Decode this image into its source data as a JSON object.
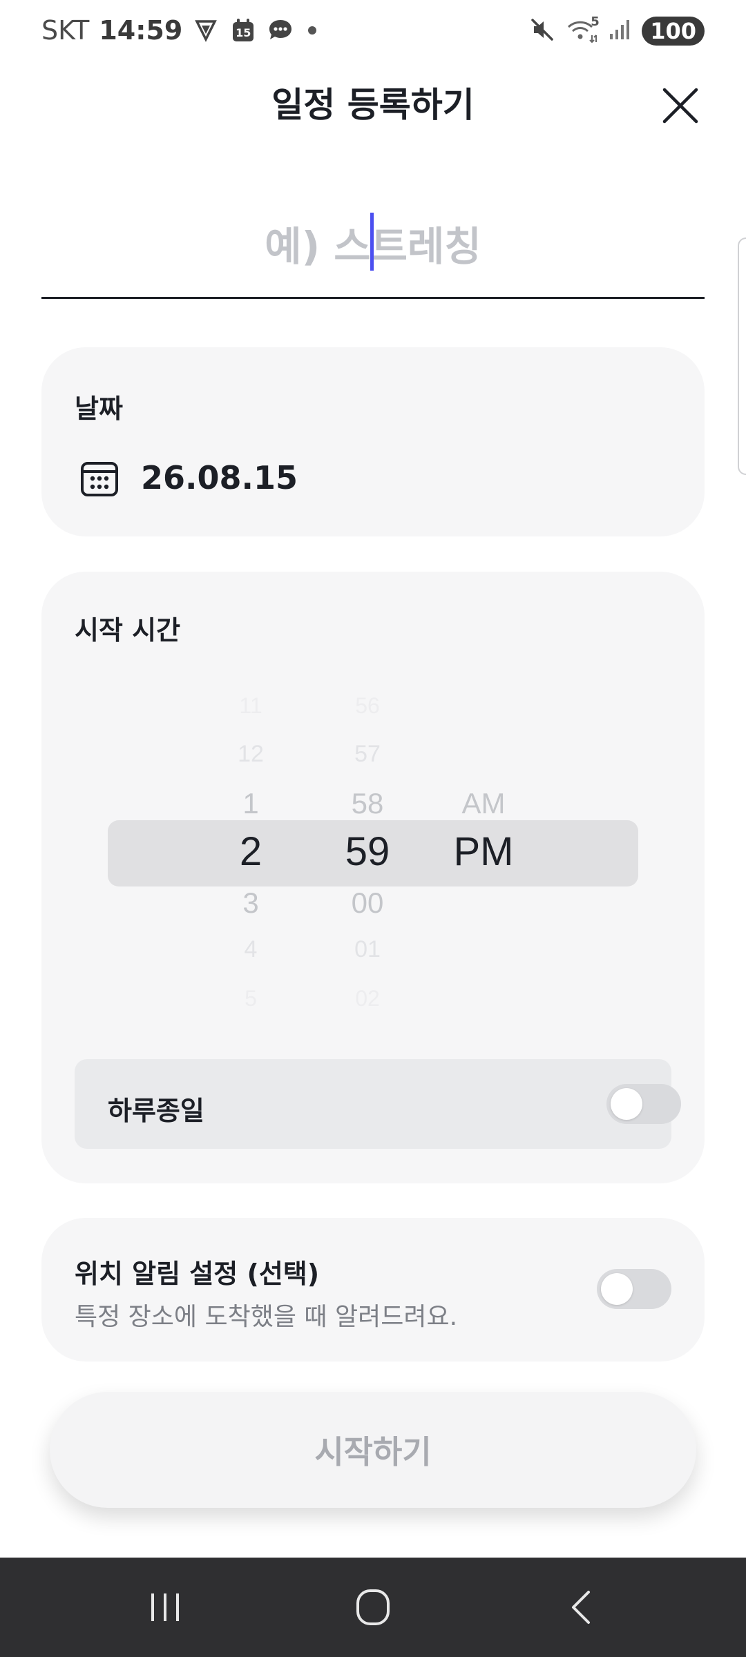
{
  "status_bar": {
    "carrier": "SKT",
    "time": "14:59",
    "calendar_badge": "15",
    "wifi_label": "5",
    "battery": "100"
  },
  "header": {
    "title": "일정 등록하기"
  },
  "title_input": {
    "placeholder": "예) 스트레칭",
    "value": ""
  },
  "date_section": {
    "label": "날짜",
    "value": "26.08.15"
  },
  "time_section": {
    "label": "시작 시간",
    "hours": [
      "11",
      "12",
      "1",
      "2",
      "3",
      "4",
      "5"
    ],
    "minutes": [
      "56",
      "57",
      "58",
      "59",
      "00",
      "01",
      "02"
    ],
    "period": [
      "AM",
      "PM"
    ],
    "selected": {
      "hour": "2",
      "minute": "59",
      "period": "PM"
    },
    "all_day": {
      "label": "하루종일",
      "enabled": false
    }
  },
  "location_section": {
    "title": "위치 알림 설정 (선택)",
    "description": "특정 장소에 도착했을 때 알려드려요.",
    "enabled": false
  },
  "start_button": {
    "label": "시작하기",
    "enabled": false
  },
  "colors": {
    "accent_caret": "#4b4ff0",
    "card_bg": "#f6f6f7",
    "disabled_text": "#a8aab0"
  }
}
